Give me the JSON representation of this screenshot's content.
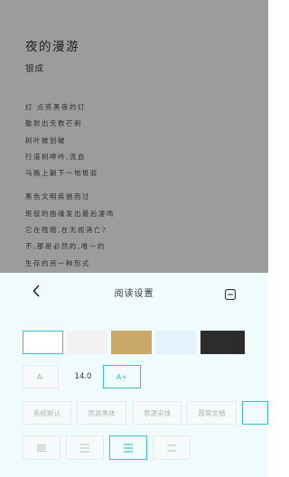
{
  "reader": {
    "title": "夜的漫游",
    "author": "银成",
    "lines": [
      "灯 点亮黑夜的灯",
      "散射出无数芒刺",
      "树叶被划破",
      "行道树呻吟,流血",
      "马路上躺下一地斑驳",
      "黑色文明疾驰而过",
      "斑驳的曲魂发出最后凄鸣",
      "它在残暗,在无视消亡?",
      "不,那是必然的,唯一的",
      "生存的另一种形式"
    ]
  },
  "settings": {
    "title": "阅读设置",
    "back_icon": "chevron-left-icon",
    "collapse_icon": "minus-square-icon",
    "themes": [
      {
        "name": "white",
        "color": "#ffffff",
        "selected": true
      },
      {
        "name": "light-gray",
        "color": "#f2f2f2",
        "selected": false
      },
      {
        "name": "tan",
        "color": "#c9a86a",
        "selected": false
      },
      {
        "name": "light-blue",
        "color": "#e3f3fd",
        "selected": false
      },
      {
        "name": "dark",
        "color": "#2c2c2c",
        "selected": false
      }
    ],
    "font_decrease": "A-",
    "font_size": "14.0",
    "font_increase": "A+",
    "fonts": [
      "系统默认",
      "思源黑体",
      "思源宋体",
      "霞鹜文楷"
    ],
    "spacing_options": [
      {
        "name": "spacing-compact",
        "selected": false
      },
      {
        "name": "spacing-normal",
        "selected": false
      },
      {
        "name": "spacing-relaxed",
        "selected": true
      },
      {
        "name": "spacing-loose",
        "selected": false
      }
    ],
    "accent_color": "#3bbfca"
  }
}
